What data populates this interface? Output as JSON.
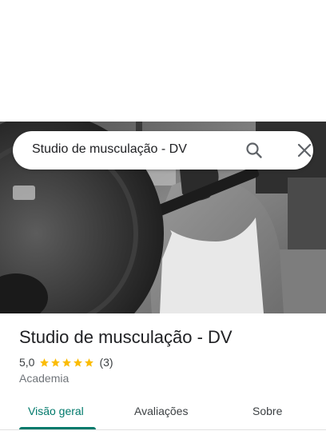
{
  "search": {
    "query": "Studio de musculação - DV",
    "search_icon": "search-icon",
    "close_icon": "close-icon"
  },
  "hero": {
    "description_icon": "gym-photo"
  },
  "place": {
    "title": "Studio de musculação - DV",
    "rating": "5,0",
    "stars": 5,
    "reviews": "(3)",
    "category": "Academia"
  },
  "tabs": [
    {
      "label": "Visão geral",
      "active": true
    },
    {
      "label": "Avaliações",
      "active": false
    },
    {
      "label": "Sobre",
      "active": false
    }
  ],
  "colors": {
    "accent": "#00796b",
    "star": "#fbbc04",
    "text_primary": "#202124",
    "text_secondary": "#70757a"
  }
}
